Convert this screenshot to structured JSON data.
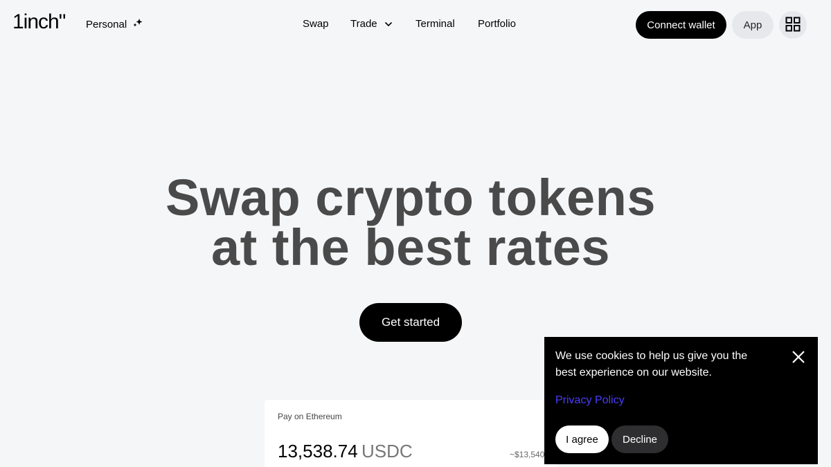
{
  "header": {
    "logo": "1inch\"",
    "persona_label": "Personal",
    "persona_icon": "sparkle-icon",
    "nav": [
      {
        "label": "Swap"
      },
      {
        "label": "Trade",
        "icon": "chevron-down-icon"
      },
      {
        "label": "Terminal"
      },
      {
        "label": "Portfolio"
      }
    ],
    "connect_label": "Connect wallet",
    "app_label": "App",
    "grid_icon": "grid-icon"
  },
  "hero": {
    "title_line1": "Swap crypto tokens",
    "title_line2": "at the best rates",
    "cta_label": "Get started"
  },
  "swap_card": {
    "label": "Pay on Ethereum",
    "amount": "13,538.74",
    "token": "USDC",
    "usd_value": "~$13,540"
  },
  "cookie_banner": {
    "text": "We use cookies to help us give you the best experience on our website.",
    "link_label": "Privacy Policy",
    "agree_label": "I agree",
    "decline_label": "Decline",
    "link_color": "#4b3cff"
  },
  "colors": {
    "background": "#f5f6f8",
    "accent": "#000000",
    "hero_text": "#4a4a4a"
  }
}
